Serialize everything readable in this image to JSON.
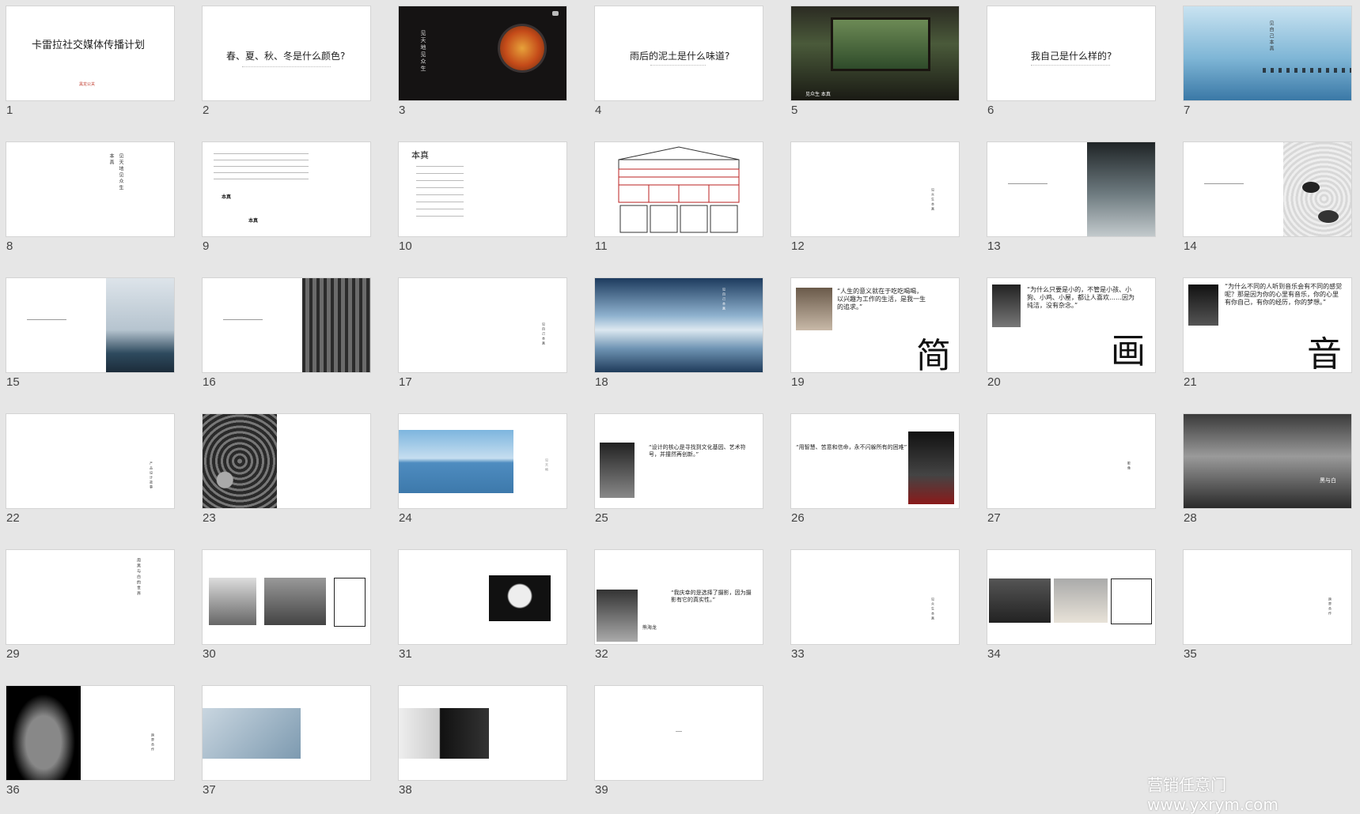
{
  "colors": {
    "background": "#e6e6e6",
    "slide": "#ffffff",
    "accent_red": "#c0392b"
  },
  "slides": [
    {
      "n": "1",
      "title": "卡雷拉社交媒体传播计划",
      "subtitle": "黑龙公关"
    },
    {
      "n": "2",
      "title": "春、夏、秋、冬是什么颜色?"
    },
    {
      "n": "3"
    },
    {
      "n": "4",
      "title": "雨后的泥土是什么味道?"
    },
    {
      "n": "5",
      "caption": "见众生 本真"
    },
    {
      "n": "6",
      "title": "我自己是什么样的?"
    },
    {
      "n": "7"
    },
    {
      "n": "8"
    },
    {
      "n": "9",
      "highlight1": "本真",
      "highlight2": "本真"
    },
    {
      "n": "10",
      "title": "本真"
    },
    {
      "n": "11"
    },
    {
      "n": "12"
    },
    {
      "n": "13"
    },
    {
      "n": "14"
    },
    {
      "n": "15"
    },
    {
      "n": "16"
    },
    {
      "n": "17"
    },
    {
      "n": "18"
    },
    {
      "n": "19",
      "quote": "“人生的意义就在于吃吃喝喝，以兴趣为工作的生活，是我一生的追求。”",
      "big": "简"
    },
    {
      "n": "20",
      "quote": "“为什么只要是小的，不管是小孩、小狗、小鸡、小屋，都让人喜欢……因为纯洁，没有杂念。”",
      "big": "画"
    },
    {
      "n": "21",
      "quote": "“为什么不同的人听到音乐会有不同的感觉呢？那是因为你的心里有音乐，你的心里有你自己，有你的经历，你的梦想。”",
      "big": "音"
    },
    {
      "n": "22"
    },
    {
      "n": "23"
    },
    {
      "n": "24"
    },
    {
      "n": "25",
      "quote": "“设计的核心是寻找到文化基因、艺术符号，并撞然再创新。”"
    },
    {
      "n": "26",
      "quote": "“用智慧、苦意和信命，永不闪躲所有的困难”"
    },
    {
      "n": "27"
    },
    {
      "n": "28",
      "caption": "黑与白"
    },
    {
      "n": "29"
    },
    {
      "n": "30"
    },
    {
      "n": "31"
    },
    {
      "n": "32",
      "quote": "“我庆幸的是选择了摄影，因为摄影有它的真实性。”",
      "name": "熊海龙"
    },
    {
      "n": "33"
    },
    {
      "n": "34"
    },
    {
      "n": "35"
    },
    {
      "n": "36"
    },
    {
      "n": "37"
    },
    {
      "n": "38"
    },
    {
      "n": "39"
    }
  ],
  "watermark": "营销任意门 www.yxrym.com"
}
